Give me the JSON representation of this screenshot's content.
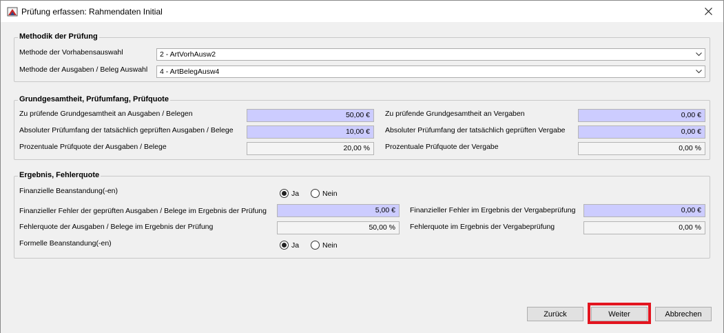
{
  "window": {
    "title": "Prüfung erfassen: Rahmendaten Initial"
  },
  "methodik": {
    "legend": "Methodik der Prüfung",
    "vorhaben_label": "Methode der Vorhabensauswahl",
    "vorhaben_value": "2 - ArtVorhAusw2",
    "belege_label": "Methode der Ausgaben / Beleg Auswahl",
    "belege_value": "4 - ArtBelegAusw4"
  },
  "grundgesamtheit": {
    "legend": "Grundgesamtheit, Prüfumfang, Prüfquote",
    "left": [
      {
        "label": "Zu prüfende Grundgesamtheit an Ausgaben / Belegen",
        "value": "50,00 €"
      },
      {
        "label": "Absoluter Prüfumfang der tatsächlich geprüften Ausgaben / Belege",
        "value": "10,00 €"
      },
      {
        "label": "Prozentuale Prüfquote der Ausgaben / Belege",
        "value": "20,00 %"
      }
    ],
    "right": [
      {
        "label": "Zu prüfende Grundgesamtheit an Vergaben",
        "value": "0,00 €"
      },
      {
        "label": "Absoluter Prüfumfang der tatsächlich geprüften Vergabe",
        "value": "0,00 €"
      },
      {
        "label": "Prozentuale Prüfquote der Vergabe",
        "value": "0,00 %"
      }
    ]
  },
  "ergebnis": {
    "legend": "Ergebnis, Fehlerquote",
    "finanz_beanstandung_label": "Finanzielle Beanstandung(-en)",
    "formell_beanstandung_label": "Formelle Beanstandung(-en)",
    "radio_ja": "Ja",
    "radio_nein": "Nein",
    "fehler_ausgaben_label": "Finanzieller Fehler der geprüften Ausgaben / Belege im Ergebnis der Prüfung",
    "fehler_ausgaben_value": "5,00 €",
    "fehlerquote_ausgaben_label": "Fehlerquote der Ausgaben / Belege im Ergebnis der Prüfung",
    "fehlerquote_ausgaben_value": "50,00 %",
    "fehler_vergabe_label": "Finanzieller Fehler im Ergebnis der Vergabeprüfung",
    "fehler_vergabe_value": "0,00 €",
    "fehlerquote_vergabe_label": "Fehlerquote im Ergebnis der Vergabeprüfung",
    "fehlerquote_vergabe_value": "0,00 %"
  },
  "buttons": {
    "back": "Zurück",
    "next": "Weiter",
    "cancel": "Abbrechen"
  },
  "colors": {
    "input_blue": "#ccccff",
    "highlight_red": "#e3151f"
  }
}
